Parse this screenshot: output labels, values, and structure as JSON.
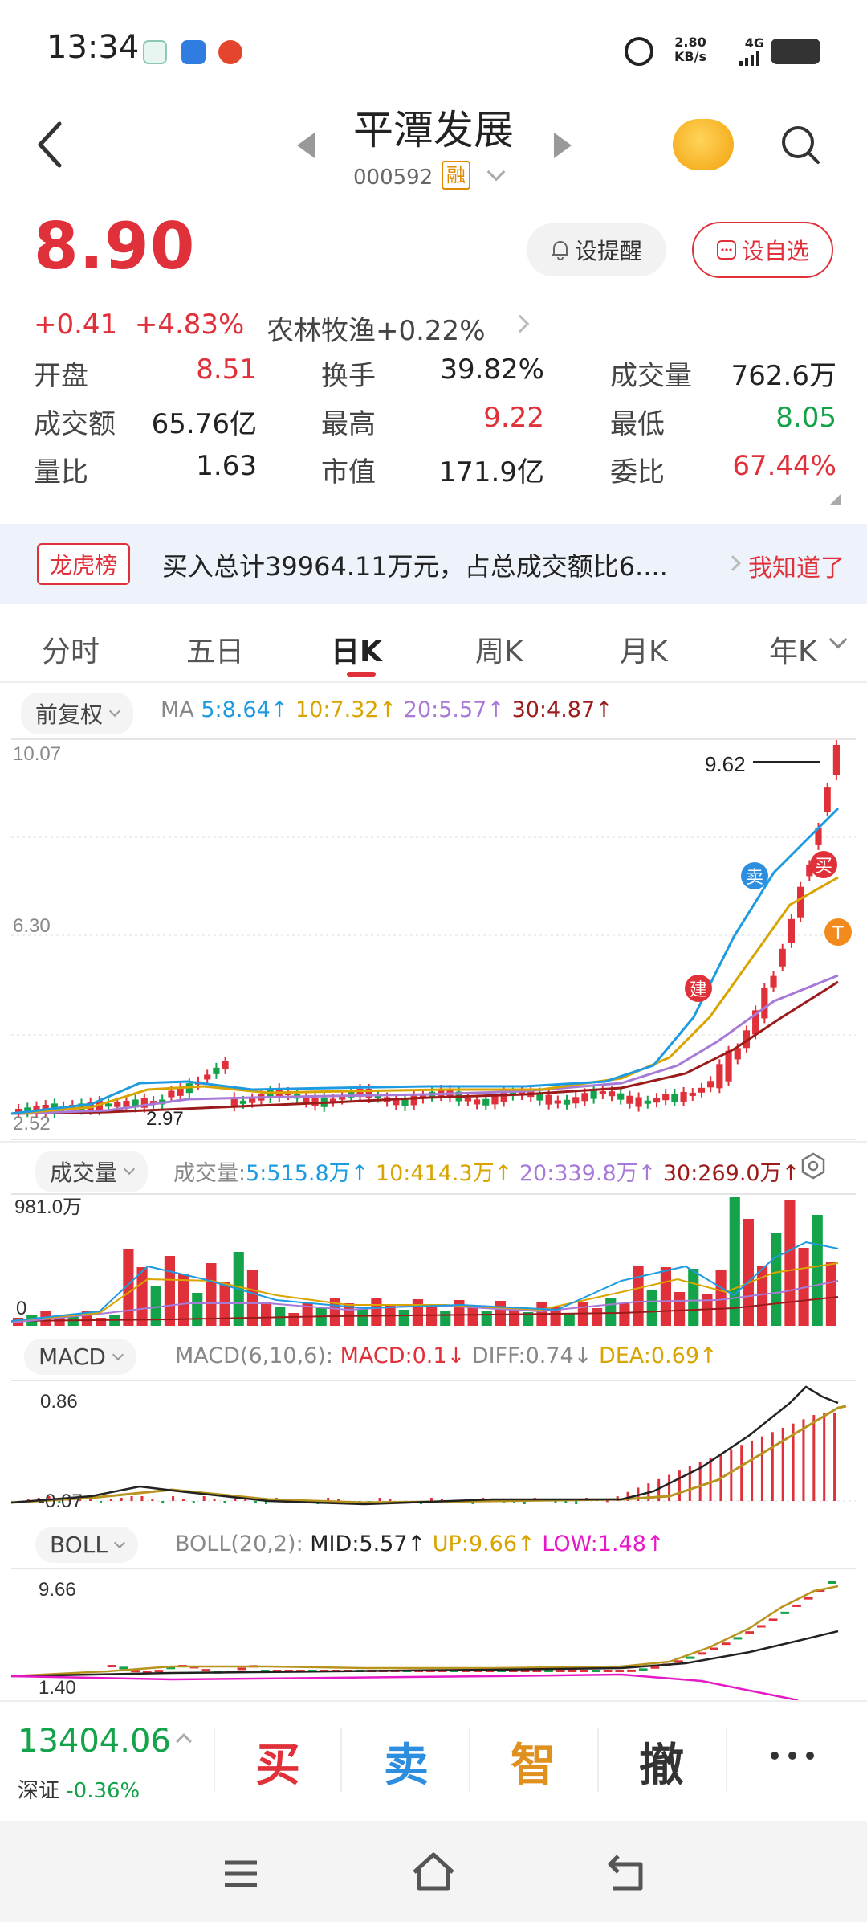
{
  "status": {
    "time": "13:34",
    "net_speed": "2.80",
    "net_unit": "KB/s",
    "network": "4G"
  },
  "header": {
    "title": "平潭发展",
    "code": "000592",
    "margin_badge": "融"
  },
  "quote": {
    "price": "8.90",
    "change": "+0.41",
    "change_pct": "+4.83%",
    "sector_name": "农林牧渔",
    "sector_change": "+0.22%",
    "remind_label": "设提醒",
    "favorite_label": "设自选"
  },
  "stats": [
    [
      {
        "label": "开盘",
        "value": "8.51",
        "color": "red"
      },
      {
        "label": "换手",
        "value": "39.82%",
        "color": "dark"
      },
      {
        "label": "成交量",
        "value": "762.6万",
        "color": "dark"
      }
    ],
    [
      {
        "label": "成交额",
        "value": "65.76亿",
        "color": "dark"
      },
      {
        "label": "最高",
        "value": "9.22",
        "color": "red"
      },
      {
        "label": "最低",
        "value": "8.05",
        "color": "green"
      }
    ],
    [
      {
        "label": "量比",
        "value": "1.63",
        "color": "dark"
      },
      {
        "label": "市值",
        "value": "171.9亿",
        "color": "dark"
      },
      {
        "label": "委比",
        "value": "67.44%",
        "color": "red"
      }
    ]
  ],
  "banner": {
    "tag": "龙虎榜",
    "text": "买入总计39964.11万元，占总成交额比6....",
    "dismiss": "我知道了"
  },
  "tabs": [
    "分时",
    "五日",
    "日K",
    "周K",
    "月K",
    "年K"
  ],
  "active_tab": "日K",
  "kline": {
    "adjust_label": "前复权",
    "ma_label": "MA",
    "ma5": "5:8.64",
    "ma10": "10:7.32",
    "ma20": "20:5.57",
    "ma30": "30:4.87",
    "axis_top": "10.07",
    "axis_mid": "6.30",
    "axis_bottom": "2.52",
    "high_mark": "9.62",
    "low_mark": "2.97",
    "marker_sell": "卖",
    "marker_buy": "买",
    "marker_build": "建",
    "marker_t": "T"
  },
  "volume": {
    "label": "成交量",
    "prefix": "成交量:",
    "v5": "5:515.8万",
    "v10": "10:414.3万",
    "v20": "20:339.8万",
    "v30": "30:269.0万",
    "axis_top": "981.0万",
    "axis_zero": "0"
  },
  "macd": {
    "label": "MACD",
    "params": "MACD(6,10,6):",
    "macd": "MACD:0.1",
    "diff": "DIFF:0.74",
    "dea": "DEA:0.69",
    "axis_top": "0.86",
    "axis_bottom": "-0.07"
  },
  "boll": {
    "label": "BOLL",
    "params": "BOLL(20,2):",
    "mid": "MID:5.57",
    "up": "UP:9.66",
    "low": "LOW:1.48",
    "axis_top": "9.66",
    "axis_bottom": "1.40"
  },
  "bottom": {
    "index_value": "13404.06",
    "index_name": "深证",
    "index_change": "-0.36%",
    "buy": "买",
    "sell": "卖",
    "smart": "智",
    "cancel": "撤"
  },
  "colors": {
    "up": "#e0313b",
    "down": "#14a34a",
    "ma5": "#1e9be0",
    "ma10": "#d9a400",
    "ma20": "#a77ad8",
    "ma30": "#9b1b1b"
  }
}
